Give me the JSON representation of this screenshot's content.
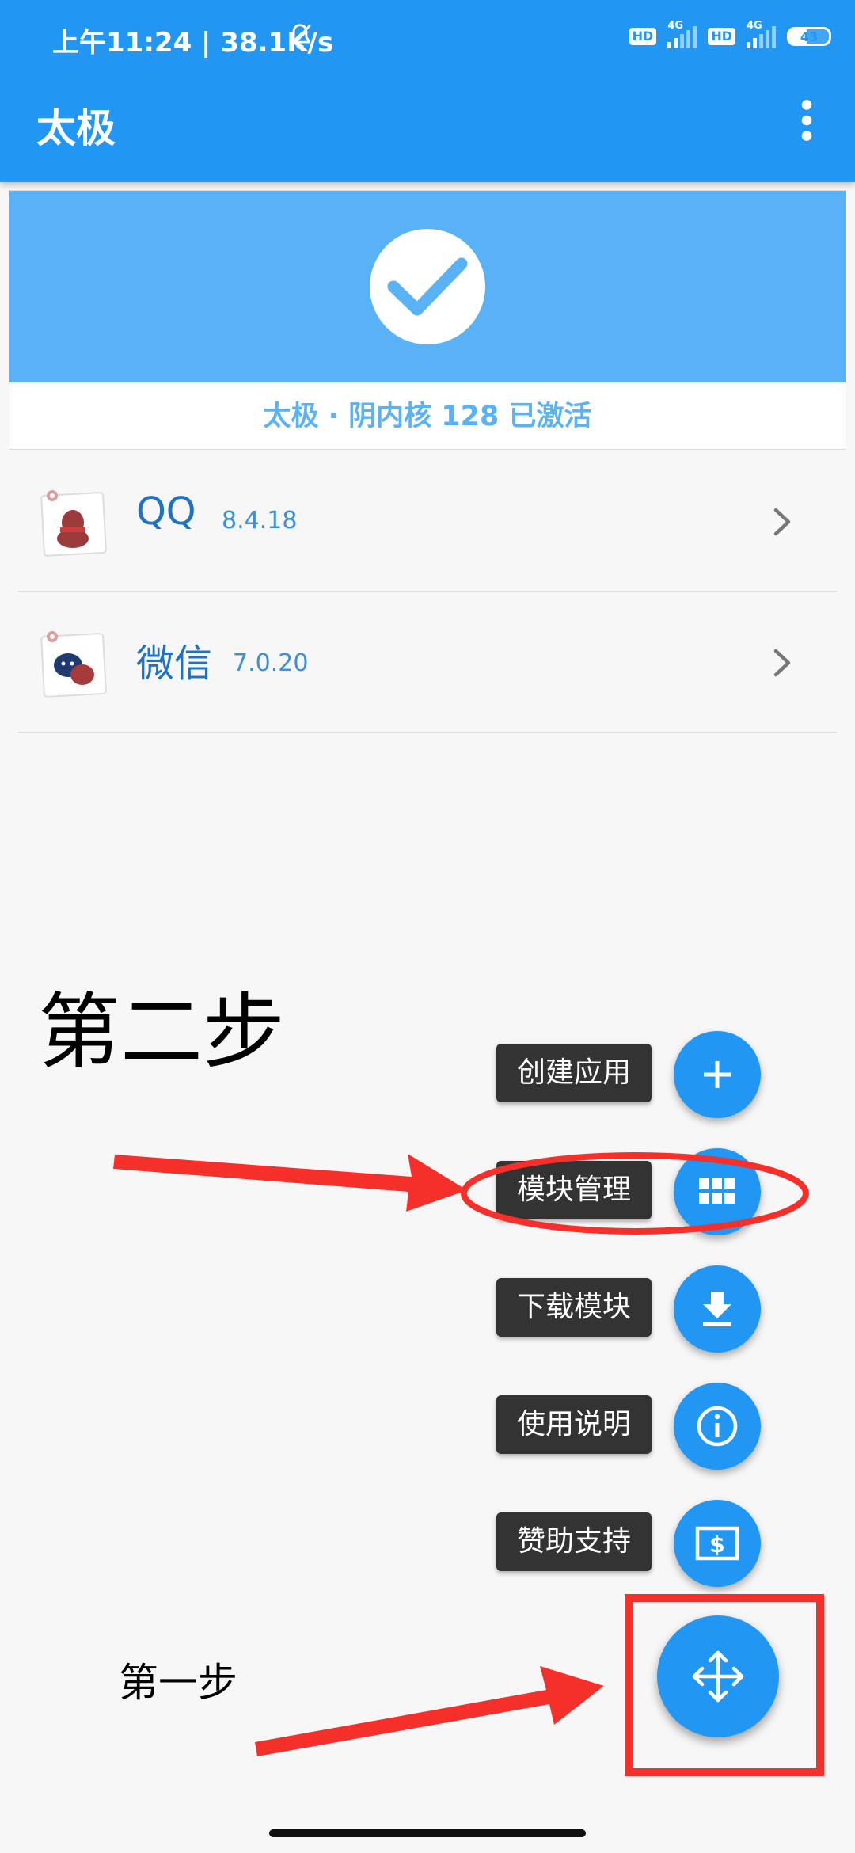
{
  "status_bar": {
    "time_speed": "上午11:24 | 38.1K/s",
    "hd_label": "HD",
    "network_label": "4G",
    "battery_level": "43"
  },
  "app_bar": {
    "title": "太极"
  },
  "status_card": {
    "text": "太极 · 阴内核 128 已激活"
  },
  "apps": [
    {
      "name": "QQ",
      "version": "8.4.18"
    },
    {
      "name": "微信",
      "version": "7.0.20"
    }
  ],
  "speed_dial": {
    "items": [
      {
        "label": "创建应用",
        "icon": "plus-icon"
      },
      {
        "label": "模块管理",
        "icon": "grid-icon"
      },
      {
        "label": "下载模块",
        "icon": "download-icon"
      },
      {
        "label": "使用说明",
        "icon": "info-icon"
      },
      {
        "label": "赞助支持",
        "icon": "dollar-icon"
      }
    ],
    "main_icon": "move-arrows-icon"
  },
  "annotations": {
    "step_two": "第二步",
    "step_one": "第一步",
    "color": "#f5302b"
  },
  "colors": {
    "primary": "#2196f3",
    "card_hero": "#5ab2f6",
    "label_bg": "#333333"
  }
}
